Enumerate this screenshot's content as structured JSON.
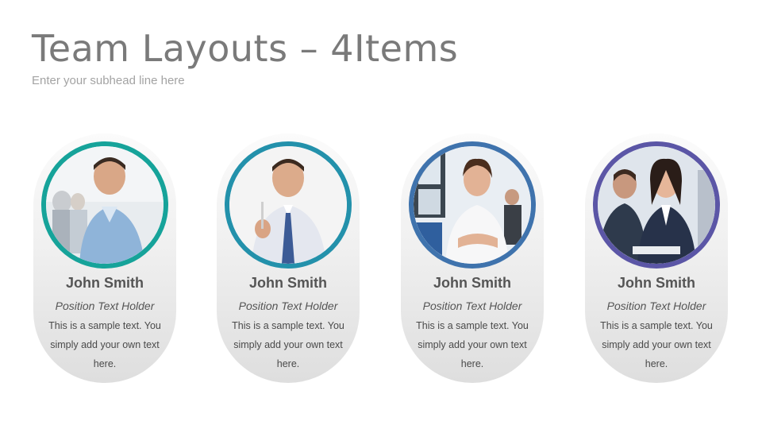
{
  "slide": {
    "title": "Team Layouts – 4Items",
    "subtitle": "Enter your subhead line here"
  },
  "members": [
    {
      "name": "John Smith",
      "position": "Position Text Holder",
      "description": "This is a sample text. You simply add your own text here.",
      "ring_color": "#16a39a",
      "photo_icon": "man-blue-shirt-office-photo"
    },
    {
      "name": "John Smith",
      "position": "Position Text Holder",
      "description": "This is a sample text. You simply add your own text here.",
      "ring_color": "#2391ab",
      "photo_icon": "man-tie-pen-photo"
    },
    {
      "name": "John Smith",
      "position": "Position Text Holder",
      "description": "This is a sample text. You simply add your own text here.",
      "ring_color": "#3f73ad",
      "photo_icon": "woman-white-shirt-office-photo"
    },
    {
      "name": "John Smith",
      "position": "Position Text Holder",
      "description": "This is a sample text. You simply add your own text here.",
      "ring_color": "#5b56a6",
      "photo_icon": "woman-dark-suit-meeting-photo"
    }
  ]
}
